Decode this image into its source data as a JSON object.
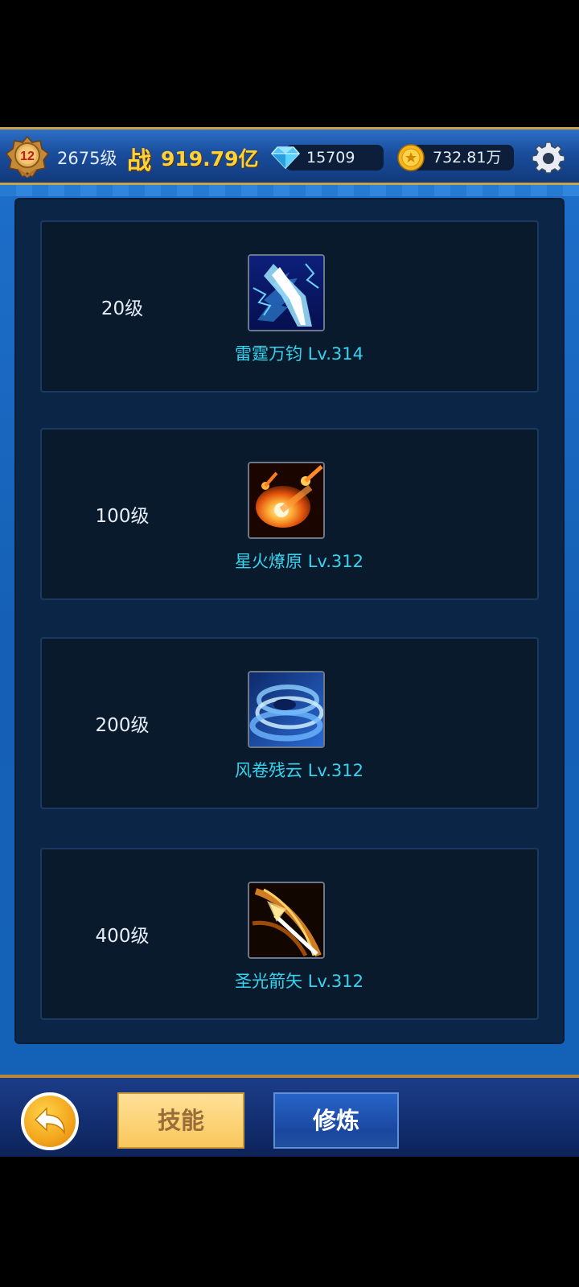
{
  "topbar": {
    "rank_badge_level": "12",
    "player_level": "2675级",
    "power_icon_text": "战",
    "power_value": "919.79亿",
    "diamonds": "15709",
    "gold": "732.81万",
    "icons": [
      "rank-badge-icon",
      "diamond-icon",
      "gold-coin-icon",
      "gear-icon"
    ]
  },
  "skills": [
    {
      "unlock_level": "20级",
      "name": "雷霆万钧 Lv.314",
      "icon": "lightning-skill-icon"
    },
    {
      "unlock_level": "100级",
      "name": "星火燎原 Lv.312",
      "icon": "meteor-fire-skill-icon"
    },
    {
      "unlock_level": "200级",
      "name": "风卷残云 Lv.312",
      "icon": "whirlwind-skill-icon"
    },
    {
      "unlock_level": "400级",
      "name": "圣光箭矢 Lv.312",
      "icon": "holy-arrow-skill-icon"
    }
  ],
  "bottombar": {
    "back_icon": "return-arrow-icon",
    "tab_skill_label": "技能",
    "tab_train_label": "修炼"
  },
  "colors": {
    "skill_name": "#35d4ee",
    "power_gold": "#ffd23a",
    "active_tab": "#f9c75c",
    "inactive_tab": "#1a47a0",
    "panel_blue": "#1560b6",
    "card_bg": "#0a1a2d"
  }
}
